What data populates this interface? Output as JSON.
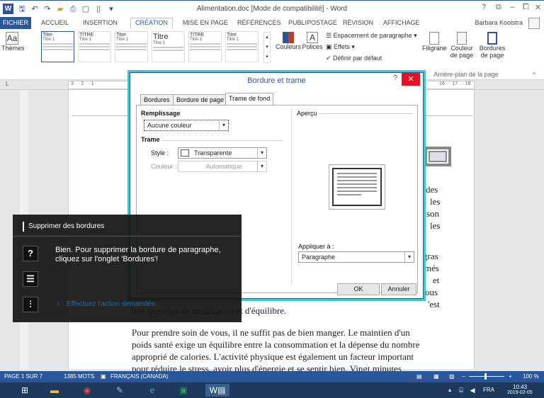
{
  "window": {
    "title": "Alimentation.doc [Mode de compatibilité] - Word",
    "help": "?",
    "controls": [
      "⧉",
      "–",
      "⧠",
      "✕"
    ]
  },
  "tabs": [
    "FICHIER",
    "ACCUEIL",
    "INSERTION",
    "CRÉATION",
    "MISE EN PAGE",
    "RÉFÉRENCES",
    "PUBLIPOSTAGE",
    "RÉVISION",
    "AFFICHAGE"
  ],
  "user": "Barbara Koolstra",
  "ribbon": {
    "themes": "Thèmes",
    "thumbs": [
      {
        "title": "Titre",
        "sub": "Titre 1"
      },
      {
        "title": "TITRE",
        "sub": "Titre 1"
      },
      {
        "title": "Titre",
        "sub": "Titre 1"
      },
      {
        "title": "Titre",
        "sub": "Titre 1"
      },
      {
        "title": "TITRE",
        "sub": "Titre 1"
      },
      {
        "title": "Titre",
        "sub": "Titre 1"
      }
    ],
    "couleurs": "Couleurs",
    "polices": "Polices",
    "espacement": "Espacement de paragraphe",
    "effets": "Effets",
    "definir": "Définir par défaut",
    "filigrane": "Filigrane",
    "couleur_page": "Couleur de page",
    "bordures_page": "Bordures de page",
    "group_label": "Arrière-plan de la page"
  },
  "ruler": {
    "left": "3 · · 2 · · 1",
    "right": "16 · · 17 · · 18"
  },
  "document": {
    "right_fragments": [
      "des",
      "les",
      "son",
      "les",
      "gras",
      "més",
      "et",
      "ous",
      "'est"
    ],
    "line1": "une question de modération et d'équilibre.",
    "para": [
      "Pour prendre soin de vous, il ne suffit pas de bien manger. Le maintien d'un",
      "poids santé exige un équilibre entre la consommation et la dépense du nombre",
      "approprié de calories. L'activité physique est également un facteur important",
      "pour réduire le stress, avoir plus d'énergie et se sentir bien. Vingt minutes"
    ]
  },
  "dialog": {
    "title": "Bordure et trame",
    "tabs": [
      "Bordures",
      "Bordure de page",
      "Trame de fond"
    ],
    "remplissage": "Remplissage",
    "remplissage_value": "Aucune couleur",
    "trame": "Trame",
    "style_label": "Style :",
    "style_value": "Transparente",
    "couleur_label": "Couleur :",
    "couleur_value": "Automatique",
    "apercu": "Aperçu",
    "appliquer_label": "Appliquer à :",
    "appliquer_value": "Paragraphe",
    "ok": "OK",
    "annuler": "Annuler"
  },
  "tip": {
    "title": "Supprimer des bordures",
    "message": "Bien. Pour supprimer la bordure de paragraphe, cliquez sur l'onglet 'Bordures'!",
    "action": "Effectuez l'action demandée."
  },
  "status": {
    "page": "PAGE 1 SUR 7",
    "words": "1385 MOTS",
    "lang": "FRANÇAIS (CANADA)",
    "zoom": "100 %"
  },
  "taskbar": {
    "lang": "FRA",
    "time": "10:43",
    "date": "2019-02-05"
  },
  "colors": {
    "accent": "#2b579a",
    "dialog_glow": "#40c4d4",
    "close": "#e81123"
  }
}
